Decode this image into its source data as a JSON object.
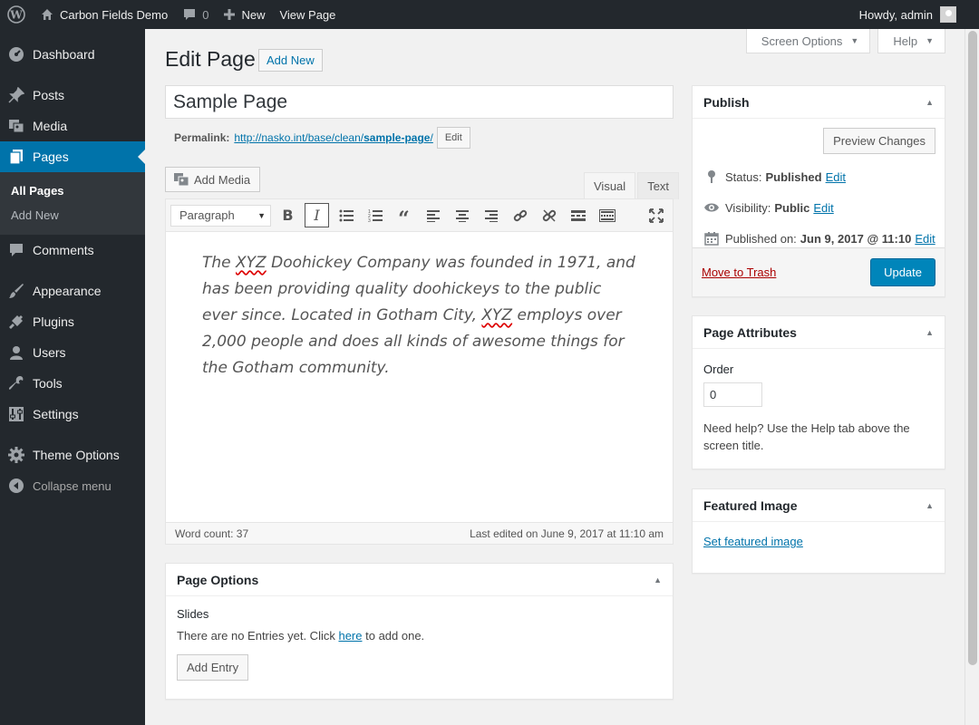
{
  "adminbar": {
    "site_name": "Carbon Fields Demo",
    "comments_count": "0",
    "new_label": "New",
    "view_page_label": "View Page",
    "howdy": "Howdy, admin"
  },
  "sidebar": {
    "items": [
      {
        "label": "Dashboard",
        "icon": "dashboard-icon"
      },
      {
        "label": "Posts",
        "icon": "pin-icon"
      },
      {
        "label": "Media",
        "icon": "media-icon"
      },
      {
        "label": "Pages",
        "icon": "pages-icon"
      },
      {
        "label": "Comments",
        "icon": "comment-icon"
      },
      {
        "label": "Appearance",
        "icon": "brush-icon"
      },
      {
        "label": "Plugins",
        "icon": "plug-icon"
      },
      {
        "label": "Users",
        "icon": "user-icon"
      },
      {
        "label": "Tools",
        "icon": "wrench-icon"
      },
      {
        "label": "Settings",
        "icon": "settings-icon"
      },
      {
        "label": "Theme Options",
        "icon": "gear-icon"
      },
      {
        "label": "Collapse menu",
        "icon": "collapse-icon"
      }
    ],
    "submenu": [
      "All Pages",
      "Add New"
    ]
  },
  "header": {
    "screen_options": "Screen Options",
    "help": "Help",
    "title": "Edit Page",
    "add_new": "Add New"
  },
  "post": {
    "title": "Sample Page",
    "permalink_label": "Permalink:",
    "permalink_base": "http://nasko.int/base/clean/",
    "permalink_slug": "sample-page",
    "permalink_trailing": "/",
    "permalink_edit": "Edit"
  },
  "editor": {
    "add_media": "Add Media",
    "tab_visual": "Visual",
    "tab_text": "Text",
    "format": "Paragraph",
    "content": {
      "p1": "The ",
      "spell1": "XYZ",
      "p2": " Doohickey Company was founded in 1971, and has been providing quality doohickeys to the public ever since. Located in Gotham City, ",
      "spell2": "XYZ",
      "p3": " employs over 2,000 people and does all kinds of awesome things for the Gotham community."
    },
    "word_count": "Word count: 37",
    "last_edited": "Last edited on June 9, 2017 at 11:10 am"
  },
  "page_options": {
    "title": "Page Options",
    "slides_label": "Slides",
    "empty_before": "There are no Entries yet. Click ",
    "empty_link": "here",
    "empty_after": " to add one.",
    "add_entry": "Add Entry"
  },
  "publish": {
    "title": "Publish",
    "preview": "Preview Changes",
    "status_label": "Status:",
    "status_value": "Published",
    "visibility_label": "Visibility:",
    "visibility_value": "Public",
    "published_label": "Published on:",
    "published_value": "Jun 9, 2017 @ 11:10",
    "edit": "Edit",
    "trash": "Move to Trash",
    "update": "Update"
  },
  "page_attributes": {
    "title": "Page Attributes",
    "order_label": "Order",
    "order_value": "0",
    "help": "Need help? Use the Help tab above the screen title."
  },
  "featured_image": {
    "title": "Featured Image",
    "link": "Set featured image"
  },
  "colors": {
    "accent": "#0073aa",
    "primary_button": "#0085ba",
    "sidebar_bg": "#23282d",
    "trash": "#aa0000"
  }
}
